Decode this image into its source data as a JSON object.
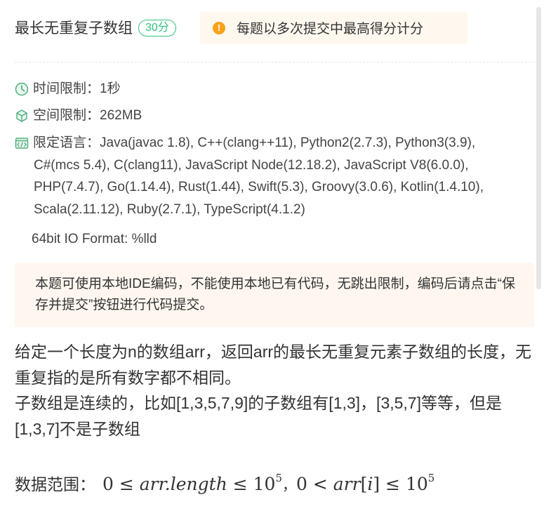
{
  "problem": {
    "title": "最长无重复子数组",
    "score_badge": "30分",
    "notice": "每题以多次提交中最高得分计分"
  },
  "limits": {
    "time_label": "时间限制：",
    "time_value": "1秒",
    "space_label": "空间限制：",
    "space_value": "262MB",
    "lang_label": "限定语言：",
    "lang_first_line": "Java(javac 1.8), C++(clang++11), Python2(2.7.3), Python3(3.9),",
    "lang_rest": "C#(mcs 5.4), C(clang11), JavaScript Node(12.18.2), JavaScript V8(6.0.0), PHP(7.4.7), Go(1.14.4), Rust(1.44), Swift(5.3), Groovy(3.0.6), Kotlin(1.4.10), Scala(2.11.12), Ruby(2.7.1), TypeScript(4.1.2)",
    "io_format": "64bit IO Format: %lld"
  },
  "tip": "本题可使用本地IDE编码，不能使用本地已有代码，无跳出限制，编码后请点击“保存并提交”按钮进行代码提交。",
  "description": {
    "para1": "给定一个长度为n的数组arr，返回arr的最长无重复元素子数组的长度，无重复指的是所有数字都不相同。",
    "para2": "子数组是连续的，比如[1,3,5,7,9]的子数组有[1,3]，[3,5,7]等等，但是[1,3,7]不是子数组",
    "range_label": "数据范围：",
    "math_part1_a": "0 ≤ ",
    "math_part1_var": "arr.length",
    "math_part1_b": " ≤ 10",
    "math_part1_exp": "5",
    "math_sep": "，",
    "math_part2_a": "0 < ",
    "math_part2_var": "arr",
    "math_part2_b": "[",
    "math_part2_idx": "i",
    "math_part2_c": "] ≤ 10",
    "math_part2_exp": "5"
  },
  "colors": {
    "badge_green": "#31c27c",
    "notice_bg": "#fff8ef",
    "notice_icon": "#f7a21b",
    "tip_bg": "#fff7ef",
    "icon_green": "#4caf7d"
  }
}
